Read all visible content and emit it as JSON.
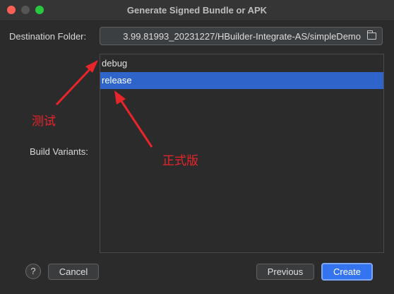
{
  "window": {
    "title": "Generate Signed Bundle or APK"
  },
  "destination": {
    "label": "Destination Folder:",
    "value": "3.99.81993_20231227/HBuilder-Integrate-AS/simpleDemo"
  },
  "build_variants": {
    "label": "Build Variants:",
    "items": [
      {
        "label": "debug"
      },
      {
        "label": "release",
        "selected": true
      }
    ]
  },
  "annotations": {
    "test_label": "测试",
    "formal_label": "正式版",
    "color": "#e8252a"
  },
  "footer": {
    "help_label": "?",
    "cancel_label": "Cancel",
    "previous_label": "Previous",
    "create_label": "Create"
  },
  "colors": {
    "accent": "#3574f0",
    "selection": "#2f65ca"
  }
}
